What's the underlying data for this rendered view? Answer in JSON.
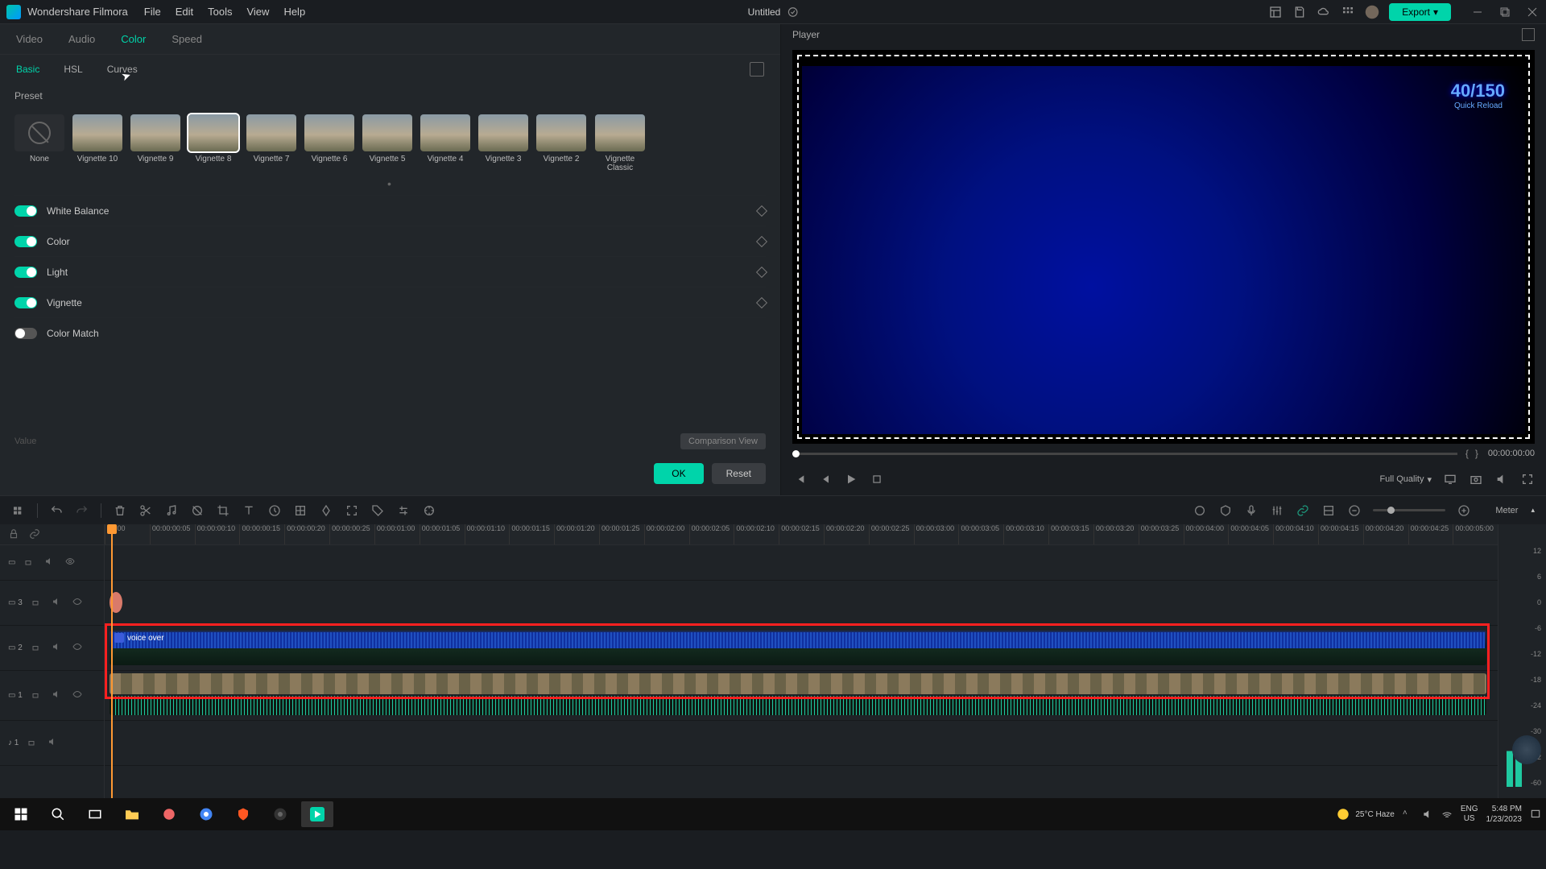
{
  "app": {
    "name": "Wondershare Filmora",
    "document": "Untitled"
  },
  "menu": [
    "File",
    "Edit",
    "Tools",
    "View",
    "Help"
  ],
  "export_label": "Export",
  "property_tabs": [
    "Video",
    "Audio",
    "Color",
    "Speed"
  ],
  "property_active": "Color",
  "color_subtabs": [
    "Basic",
    "HSL",
    "Curves"
  ],
  "color_subtab_active": "Basic",
  "preset_label": "Preset",
  "presets": [
    {
      "name": "None",
      "none": true
    },
    {
      "name": "Vignette 10"
    },
    {
      "name": "Vignette 9"
    },
    {
      "name": "Vignette 8",
      "selected": true
    },
    {
      "name": "Vignette 7"
    },
    {
      "name": "Vignette 6"
    },
    {
      "name": "Vignette 5"
    },
    {
      "name": "Vignette 4"
    },
    {
      "name": "Vignette 3"
    },
    {
      "name": "Vignette 2"
    },
    {
      "name": "Vignette Classic"
    }
  ],
  "adjustments": [
    {
      "label": "White Balance",
      "on": true,
      "kf": true
    },
    {
      "label": "Color",
      "on": true,
      "kf": true
    },
    {
      "label": "Light",
      "on": true,
      "kf": true
    },
    {
      "label": "Vignette",
      "on": true,
      "kf": true
    },
    {
      "label": "Color Match",
      "on": false,
      "kf": false
    }
  ],
  "value_label": "Value",
  "compare_label": "Comparison View",
  "ok_label": "OK",
  "reset_label": "Reset",
  "player": {
    "title": "Player",
    "timecode": "00:00:00:00",
    "quality": "Full Quality",
    "hud_main": "40/150",
    "hud_sub": "Quick Reload"
  },
  "meter_label": "Meter",
  "ruler_ticks": [
    "00:00",
    "00:00:00:05",
    "00:00:00:10",
    "00:00:00:15",
    "00:00:00:20",
    "00:00:00:25",
    "00:00:01:00",
    "00:00:01:05",
    "00:00:01:10",
    "00:00:01:15",
    "00:00:01:20",
    "00:00:01:25",
    "00:00:02:00",
    "00:00:02:05",
    "00:00:02:10",
    "00:00:02:15",
    "00:00:02:20",
    "00:00:02:25",
    "00:00:03:00",
    "00:00:03:05",
    "00:00:03:10",
    "00:00:03:15",
    "00:00:03:20",
    "00:00:03:25",
    "00:00:04:00",
    "00:00:04:05",
    "00:00:04:10",
    "00:00:04:15",
    "00:00:04:20",
    "00:00:04:25",
    "00:00:05:00"
  ],
  "meter_scale": [
    "12",
    "6",
    "0",
    "-6",
    "-12",
    "-18",
    "-24",
    "-30",
    "-42",
    "-60"
  ],
  "clip_voiceover_label": "voice over",
  "system": {
    "weather": "25°C  Haze",
    "lang1": "ENG",
    "lang2": "US",
    "time": "5:48 PM",
    "date": "1/23/2023"
  }
}
